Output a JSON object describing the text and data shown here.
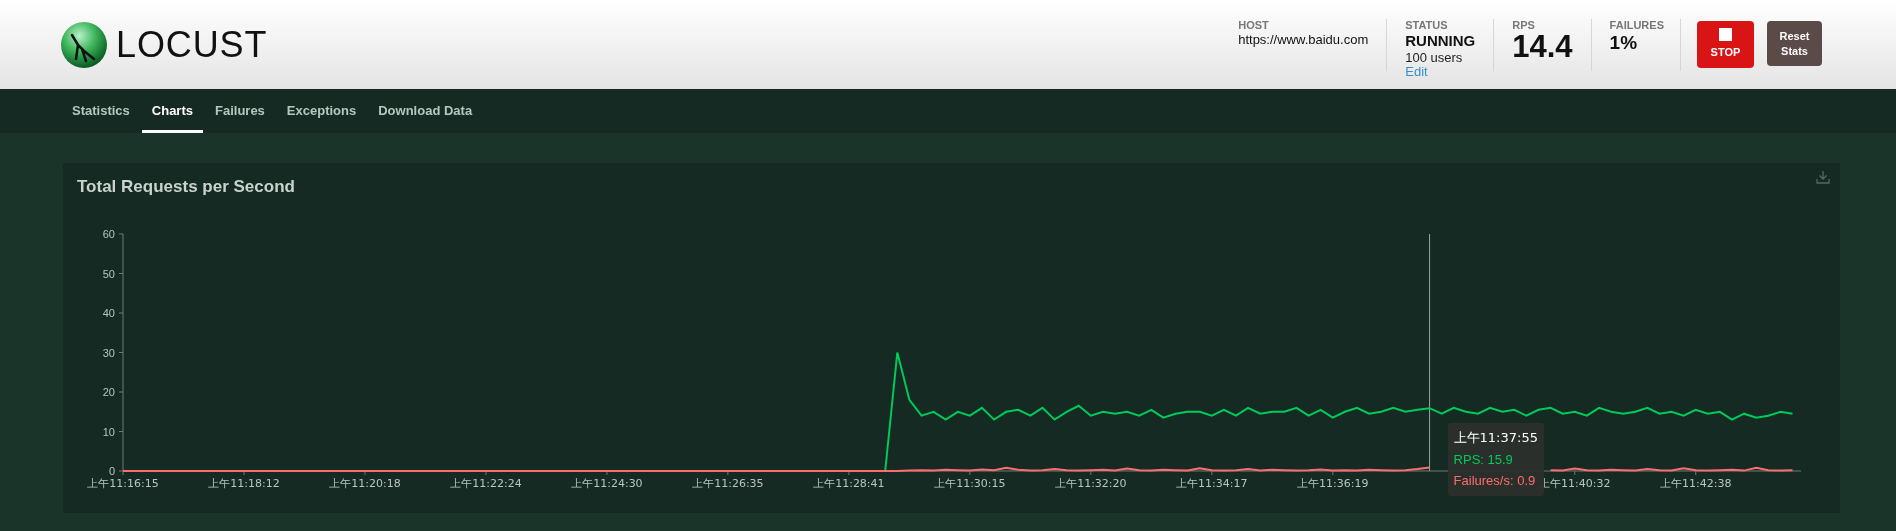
{
  "app": {
    "logo_text": "LOCUST"
  },
  "stats": [
    {
      "label": "HOST",
      "value": "https://www.baidu.com",
      "kind": "text"
    },
    {
      "label": "STATUS",
      "value": "RUNNING",
      "sub": "100 users",
      "link": "Edit",
      "kind": "status"
    },
    {
      "label": "RPS",
      "value": "14.4",
      "kind": "big"
    },
    {
      "label": "FAILURES",
      "value": "1%",
      "kind": "medium"
    }
  ],
  "buttons": [
    {
      "label": "STOP",
      "kind": "stop"
    },
    {
      "label": "Reset Stats",
      "kind": "reset"
    }
  ],
  "tabs": [
    {
      "label": "Statistics",
      "selected": false
    },
    {
      "label": "Charts",
      "selected": true
    },
    {
      "label": "Failures",
      "selected": false
    },
    {
      "label": "Exceptions",
      "selected": false
    },
    {
      "label": "Download Data",
      "selected": false
    }
  ],
  "chart": {
    "chart_data": {
      "type": "line",
      "title": "Total Requests per Second",
      "categories": [
        "上午11:16:15",
        null,
        null,
        null,
        null,
        null,
        null,
        null,
        null,
        null,
        "上午11:18:12",
        null,
        null,
        null,
        null,
        null,
        null,
        null,
        null,
        null,
        "上午11:20:18",
        null,
        null,
        null,
        null,
        null,
        null,
        null,
        null,
        null,
        "上午11:22:24",
        null,
        null,
        null,
        null,
        null,
        null,
        null,
        null,
        null,
        "上午11:24:30",
        null,
        null,
        null,
        null,
        null,
        null,
        null,
        null,
        null,
        "上午11:26:35",
        null,
        null,
        null,
        null,
        null,
        null,
        null,
        null,
        null,
        "上午11:28:41",
        null,
        null,
        null,
        null,
        null,
        null,
        null,
        null,
        null,
        "上午11:30:15",
        null,
        null,
        null,
        null,
        null,
        null,
        null,
        null,
        null,
        "上午11:32:20",
        null,
        null,
        null,
        null,
        null,
        null,
        null,
        null,
        null,
        "上午11:34:17",
        null,
        null,
        null,
        null,
        null,
        null,
        null,
        null,
        null,
        "上午11:36:19",
        null,
        null,
        null,
        null,
        null,
        null,
        null,
        null,
        null,
        null,
        null,
        null,
        null,
        null,
        null,
        null,
        null,
        null,
        null,
        "上午11:40:32",
        null,
        null,
        null,
        null,
        null,
        null,
        null,
        null,
        null,
        "上午11:42:38",
        null,
        null,
        null,
        null,
        null,
        null,
        null,
        null
      ],
      "series": [
        {
          "name": "RPS",
          "color": "#00ca5a",
          "values": [
            null,
            null,
            null,
            null,
            null,
            null,
            null,
            null,
            null,
            null,
            null,
            null,
            null,
            null,
            null,
            null,
            null,
            null,
            null,
            null,
            null,
            null,
            null,
            null,
            null,
            null,
            null,
            null,
            null,
            null,
            null,
            null,
            null,
            null,
            null,
            null,
            null,
            null,
            null,
            null,
            null,
            null,
            null,
            null,
            null,
            null,
            null,
            null,
            null,
            null,
            null,
            null,
            null,
            null,
            null,
            null,
            null,
            null,
            null,
            null,
            null,
            null,
            null,
            0,
            30,
            18,
            14,
            15,
            13,
            15,
            14,
            16,
            13,
            15,
            15.5,
            14,
            16,
            13,
            15,
            16.5,
            14,
            15,
            14.5,
            15,
            14,
            15.5,
            13.5,
            14.5,
            15,
            15,
            14,
            15.5,
            14,
            16,
            14.5,
            15,
            15,
            16,
            14,
            15.5,
            13.5,
            15,
            16,
            14.5,
            15,
            16,
            15,
            15.5,
            15.9,
            14.5,
            16,
            15,
            14.5,
            16,
            15,
            15.5,
            14,
            15.5,
            16,
            14.5,
            15,
            14,
            16,
            15,
            14.5,
            15,
            16,
            14.5,
            15,
            14,
            15.5,
            14.5,
            15,
            13,
            14.5,
            13.5,
            14,
            15,
            14.5
          ]
        },
        {
          "name": "Failures/s",
          "color": "#ff6d6d",
          "values": [
            0,
            0,
            0,
            0,
            0,
            0,
            0,
            0,
            0,
            0,
            0,
            0,
            0,
            0,
            0,
            0,
            0,
            0,
            0,
            0,
            0,
            0,
            0,
            0,
            0,
            0,
            0,
            0,
            0,
            0,
            0,
            0,
            0,
            0,
            0,
            0,
            0,
            0,
            0,
            0,
            0,
            0,
            0,
            0,
            0,
            0,
            0,
            0,
            0,
            0,
            0,
            0,
            0,
            0,
            0,
            0,
            0,
            0,
            0,
            0,
            0,
            0,
            0,
            0,
            0,
            0.1,
            0.2,
            0.1,
            0.3,
            0.2,
            0.1,
            0.4,
            0.2,
            0.8,
            0.3,
            0.1,
            0.2,
            0.5,
            0.2,
            0.1,
            0.2,
            0.3,
            0.1,
            0.6,
            0.2,
            0.1,
            0.3,
            0.2,
            0.1,
            0.7,
            0.2,
            0.1,
            0.2,
            0.5,
            0.1,
            0.3,
            0.2,
            0.1,
            0.2,
            0.4,
            0.1,
            0.2,
            0.1,
            0.3,
            0.2,
            0.1,
            0.2,
            0.5,
            0.9,
            null,
            null,
            null,
            null,
            null,
            null,
            null,
            null,
            null,
            0.2,
            0.1,
            0.6,
            0.2,
            0.1,
            0.3,
            0.2,
            0.1,
            0.5,
            0.2,
            0.1,
            0.7,
            0.2,
            0.1,
            0.2,
            0.3,
            0.1,
            0.8,
            0.2,
            0.1,
            0.2
          ]
        }
      ],
      "ylim": [
        0,
        60
      ],
      "yticks": [
        0,
        10,
        20,
        30,
        40,
        50,
        60
      ]
    },
    "tooltip": {
      "title": "上午11:37:55",
      "values": [
        ": 15.9",
        ": 0.9"
      ]
    }
  }
}
